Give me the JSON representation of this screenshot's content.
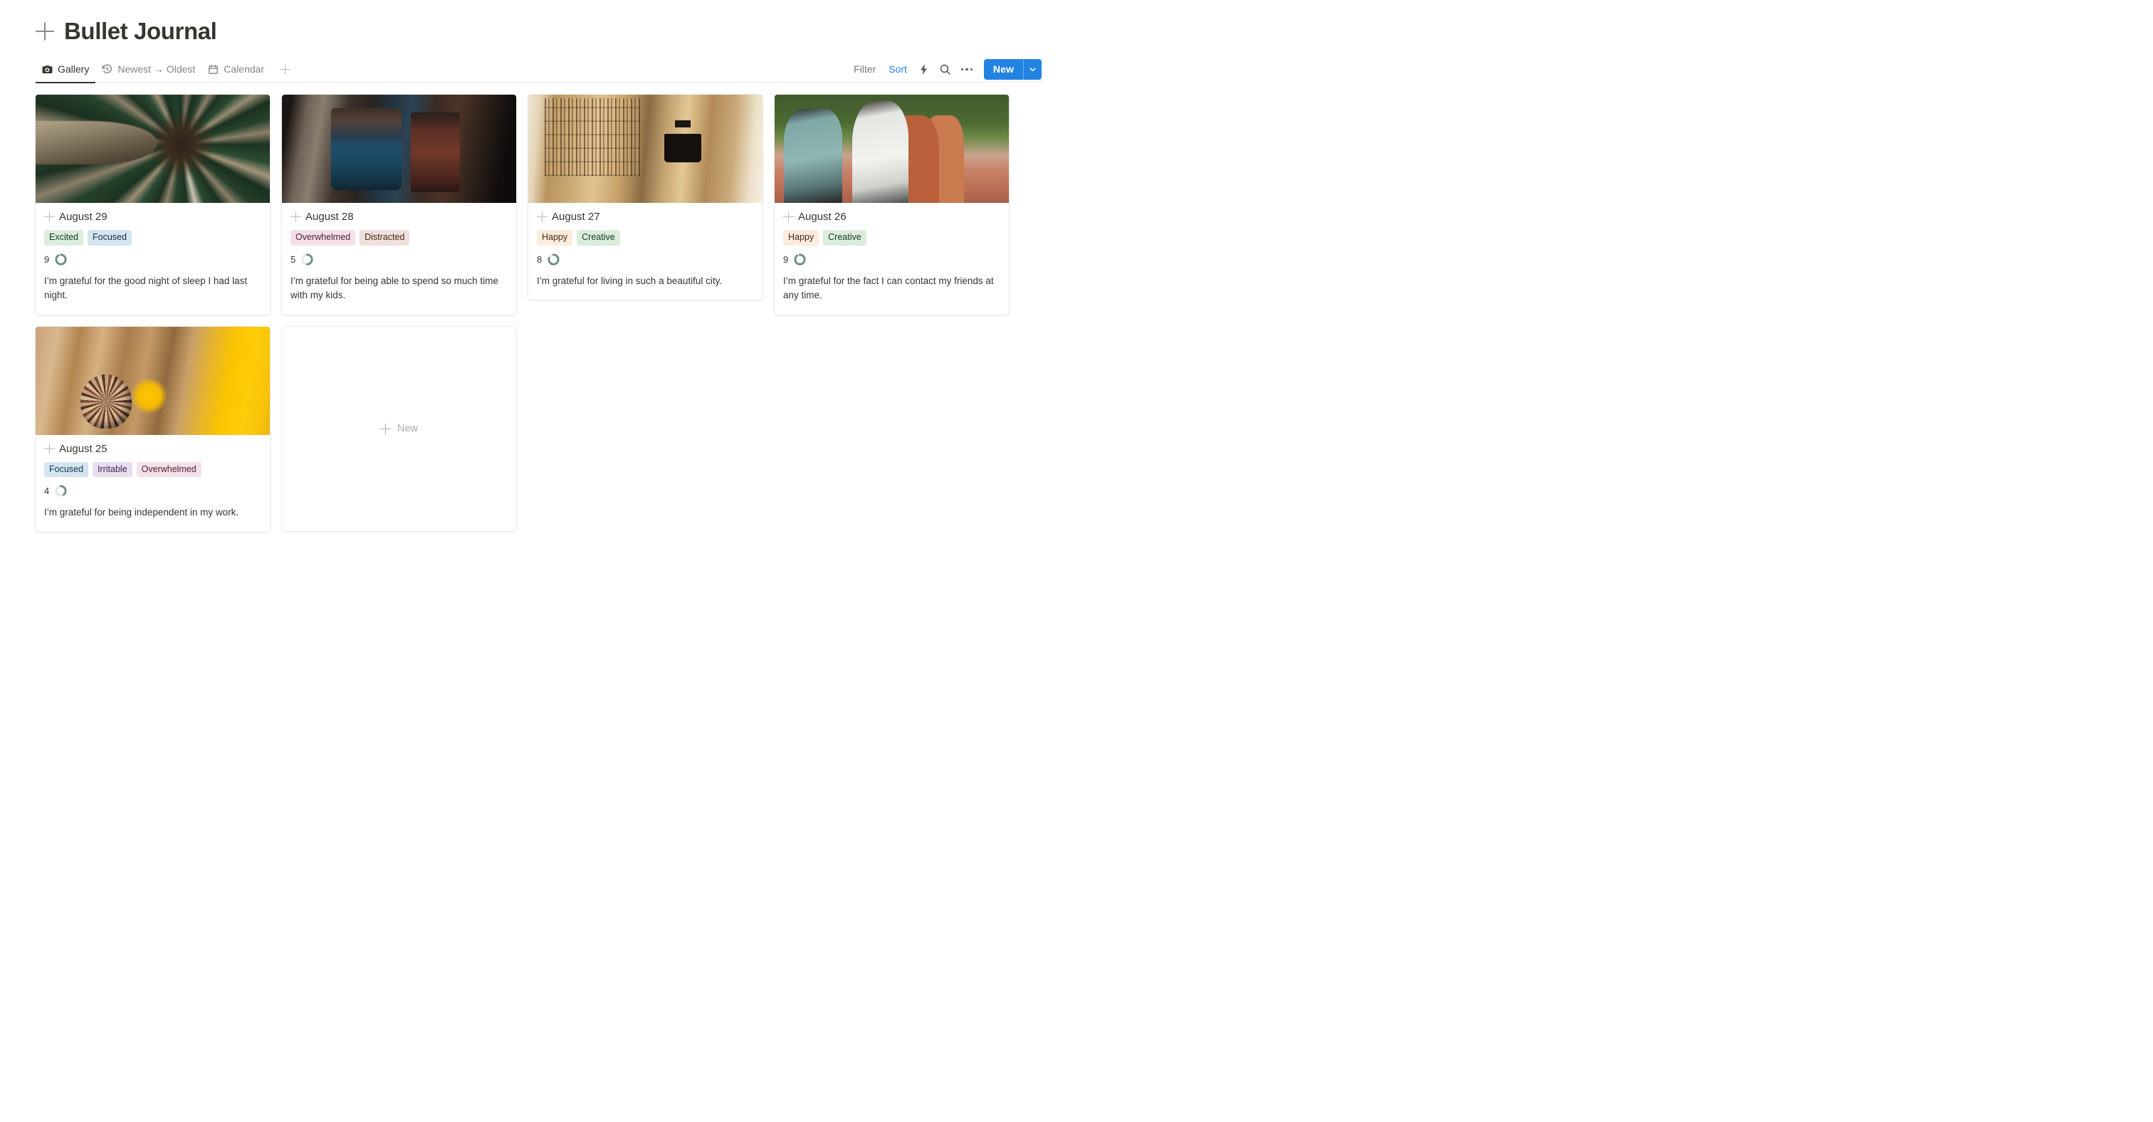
{
  "header": {
    "title": "Bullet Journal",
    "add_icon": "plus-icon"
  },
  "tabs": [
    {
      "label": "Gallery",
      "icon": "camera-icon",
      "active": true
    },
    {
      "label": "Newest → Oldest",
      "icon": "history-icon",
      "active": false
    },
    {
      "label": "Calendar",
      "icon": "calendar-icon",
      "active": false
    }
  ],
  "tab_add_label": "add-view",
  "toolbar": {
    "filter_label": "Filter",
    "sort_label": "Sort",
    "lightning_icon": "lightning-icon",
    "search_icon": "search-icon",
    "more_icon": "ellipsis-icon",
    "new_label": "New",
    "new_chevron_icon": "chevron-down-icon",
    "accent_color": "#2383e2",
    "muted_color": "#787774"
  },
  "tag_colors": {
    "Excited": {
      "bg": "#dbeddb",
      "fg": "#1c3829"
    },
    "Focused": {
      "bg": "#d3e5ef",
      "fg": "#183347"
    },
    "Overwhelmed": {
      "bg": "#f5e0e9",
      "fg": "#4c2238"
    },
    "Distracted": {
      "bg": "#eee0da",
      "fg": "#442a1e"
    },
    "Happy": {
      "bg": "#fbecdd",
      "fg": "#49290e"
    },
    "Creative": {
      "bg": "#dbeddb",
      "fg": "#1c3829"
    },
    "Irritable": {
      "bg": "#e8deee",
      "fg": "#412454"
    }
  },
  "rating": {
    "max": 10,
    "fill_color": "#6d8f7e",
    "track_color": "#e6e6e4"
  },
  "cards": [
    {
      "date": "August 29",
      "photo": "palm-tree-from-below",
      "tags": [
        "Excited",
        "Focused"
      ],
      "score": 9,
      "note": "I’m grateful for the good night of sleep I had last night."
    },
    {
      "date": "August 28",
      "photo": "desk-with-pens-and-mug",
      "tags": [
        "Overwhelmed",
        "Distracted"
      ],
      "score": 5,
      "note": "I’m grateful for being able to spend so much time with my kids."
    },
    {
      "date": "August 27",
      "photo": "warm-library-interior",
      "tags": [
        "Happy",
        "Creative"
      ],
      "score": 8,
      "note": "I’m grateful for living in such a beautiful city."
    },
    {
      "date": "August 26",
      "photo": "three-friends-talking-outdoors",
      "tags": [
        "Happy",
        "Creative"
      ],
      "score": 9,
      "note": "I’m grateful for the fact I can contact my friends at any time."
    },
    {
      "date": "August 25",
      "photo": "snail-on-yellow-lichen-rock",
      "tags": [
        "Focused",
        "Irritable",
        "Overwhelmed"
      ],
      "score": 4,
      "note": "I’m grateful for being independent in my work."
    }
  ],
  "new_card": {
    "label": "New",
    "icon": "plus-icon"
  }
}
